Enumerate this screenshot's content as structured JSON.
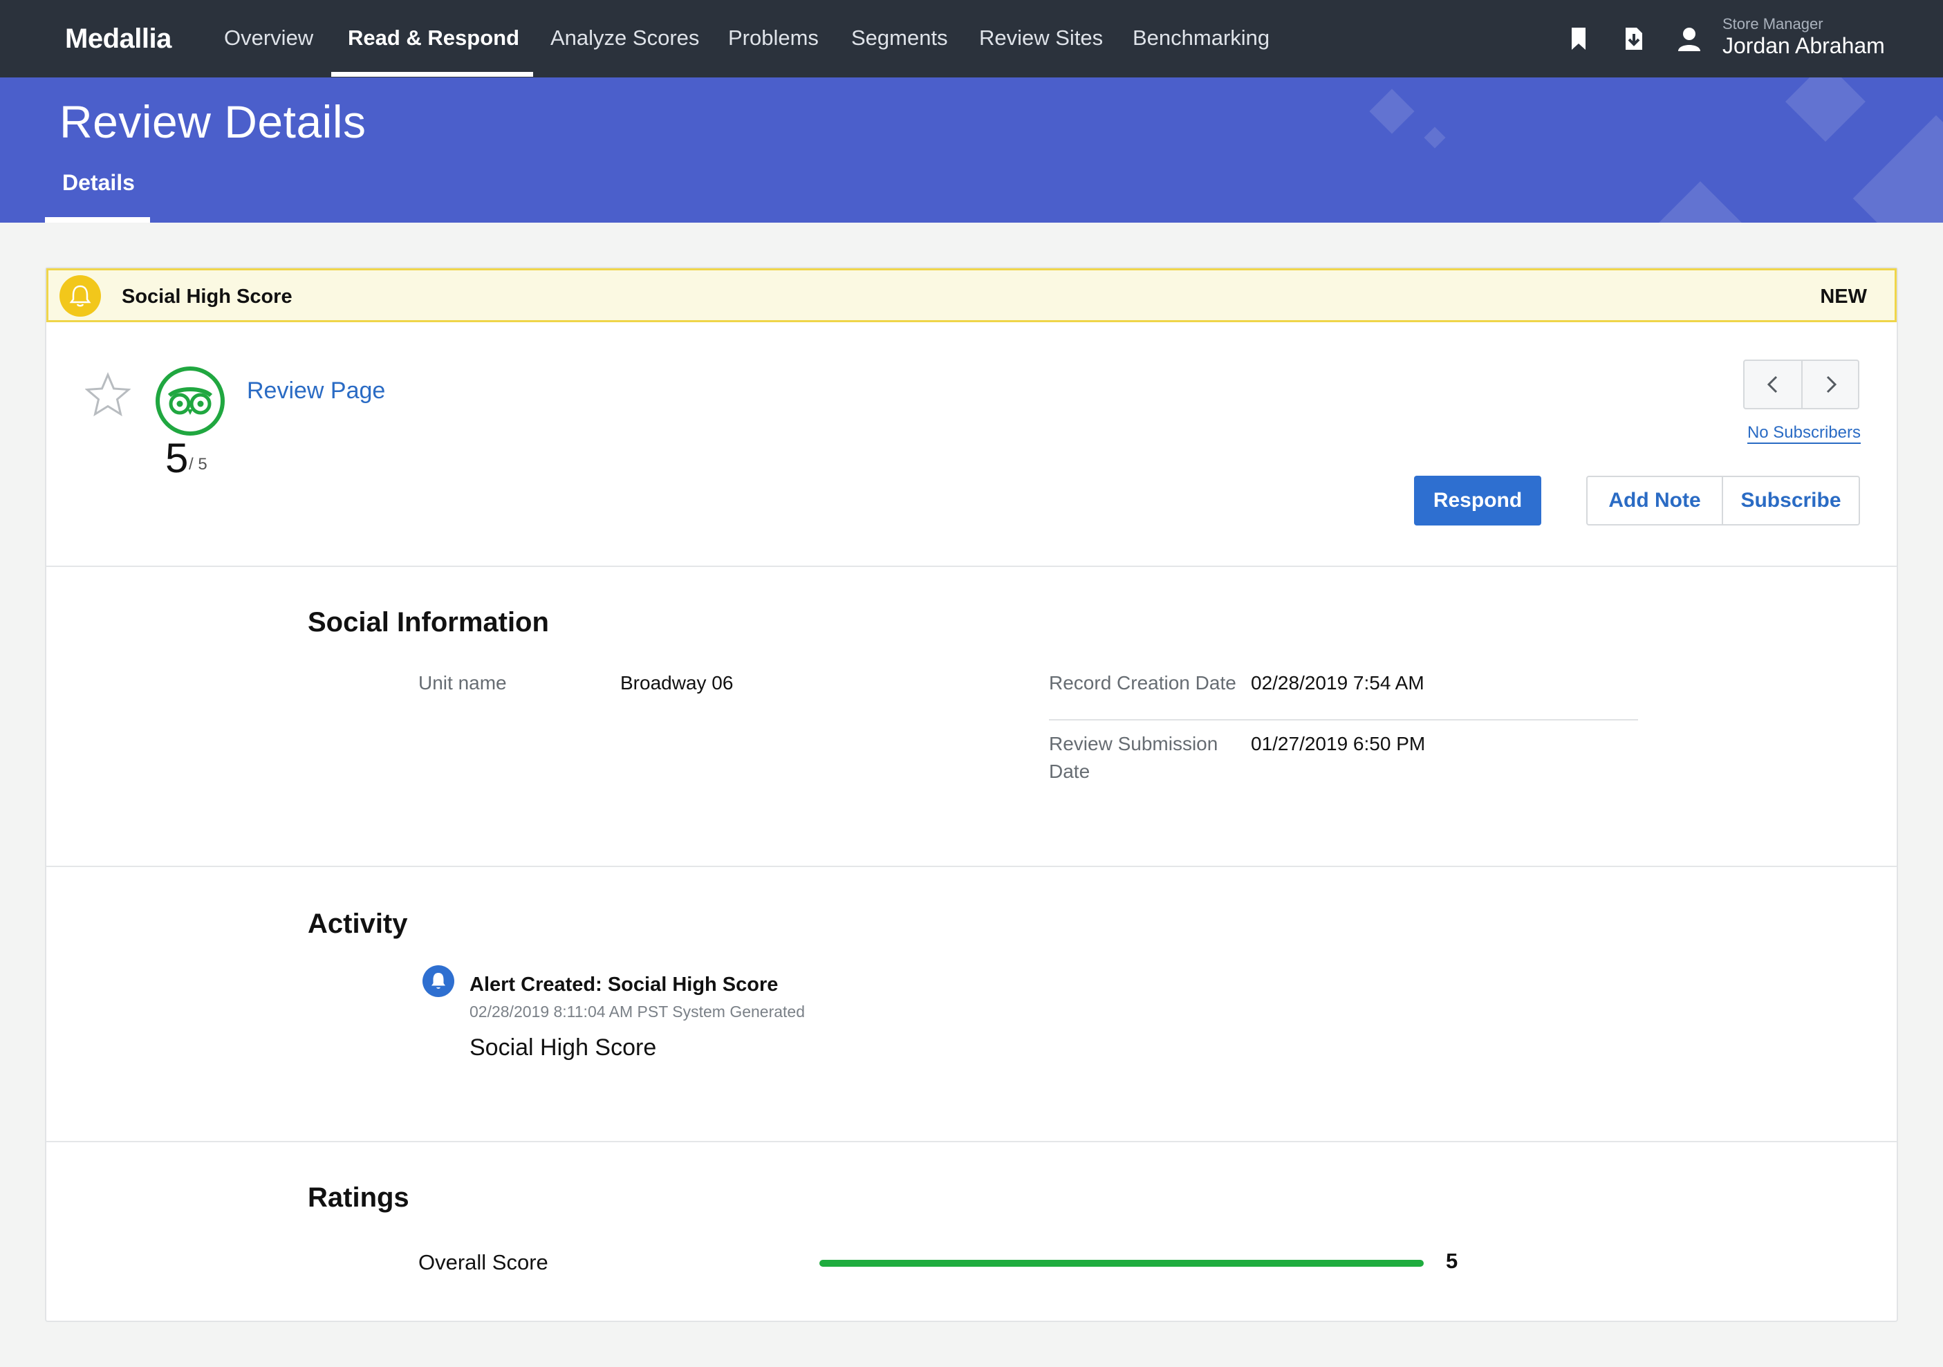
{
  "nav": {
    "logo": "Medallia",
    "items": [
      "Overview",
      "Read & Respond",
      "Analyze Scores",
      "Problems",
      "Segments",
      "Review Sites",
      "Benchmarking"
    ],
    "active_index": 1,
    "icons": [
      "bookmark-icon",
      "download-icon",
      "user-icon"
    ],
    "user_role": "Store Manager",
    "user_name": "Jordan Abraham"
  },
  "header": {
    "title": "Review Details",
    "tab": "Details"
  },
  "alert": {
    "title": "Social High Score",
    "status": "NEW"
  },
  "review": {
    "source_icon": "tripadvisor-owl-icon",
    "score": "5",
    "score_max": "/ 5",
    "link_label": "Review Page",
    "subscribers_label": "No Subscribers",
    "actions": {
      "respond": "Respond",
      "add_note": "Add Note",
      "subscribe": "Subscribe"
    }
  },
  "social_information": {
    "title": "Social Information",
    "unit_name_label": "Unit name",
    "unit_name_value": "Broadway 06",
    "record_creation_label": "Record Creation Date",
    "record_creation_value": "02/28/2019 7:54 AM",
    "review_submission_label_line1": "Review Submission",
    "review_submission_label_line2": "Date",
    "review_submission_value": "01/27/2019 6:50 PM"
  },
  "activity": {
    "title": "Activity",
    "entries": [
      {
        "title": "Alert Created: Social High Score",
        "meta": "02/28/2019 8:11:04 AM PST System Generated",
        "body": "Social High Score"
      }
    ]
  },
  "ratings": {
    "title": "Ratings",
    "items": [
      {
        "label": "Overall Score",
        "value": "5",
        "fraction": 1.0
      }
    ]
  },
  "colors": {
    "nav_bg": "#2b323c",
    "header_bg": "#4b5fcb",
    "primary": "#2e6fd0",
    "alert_bg": "#fbf9e2",
    "alert_border": "#efd54a",
    "rating_green": "#1fac3f"
  }
}
